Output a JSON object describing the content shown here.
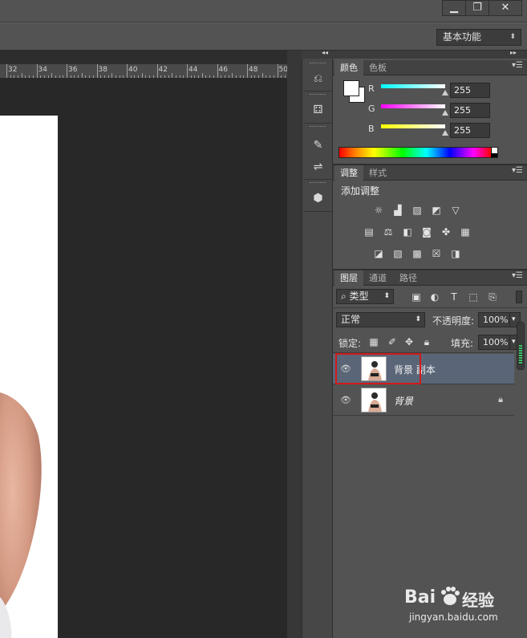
{
  "window": {
    "minimize": "▁",
    "restore": "❐",
    "close": "✕"
  },
  "options_bar": {
    "workspace": "基本功能"
  },
  "ruler": {
    "labels": [
      "32",
      "34",
      "36",
      "38",
      "40",
      "42",
      "44",
      "46",
      "48",
      "50"
    ]
  },
  "dock": {
    "collapse_arrows": "◂◂",
    "expand_arrows": "▸▸"
  },
  "color_panel": {
    "tabs": [
      "颜色",
      "色板"
    ],
    "channels": [
      {
        "label": "R",
        "value": "255",
        "gradient": "linear-gradient(to right,#00ffff,#ffffff)"
      },
      {
        "label": "G",
        "value": "255",
        "gradient": "linear-gradient(to right,#ff00ff,#ffffff)"
      },
      {
        "label": "B",
        "value": "255",
        "gradient": "linear-gradient(to right,#ffff00,#ffffff)"
      }
    ]
  },
  "adjustments_panel": {
    "tabs": [
      "调整",
      "样式"
    ],
    "title": "添加调整",
    "icon_rows": [
      [
        "brightness-contrast-icon",
        "levels-icon",
        "curves-icon",
        "exposure-icon",
        "vibrance-icon"
      ],
      [
        "hue-saturation-icon",
        "color-balance-icon",
        "black-white-icon",
        "photo-filter-icon",
        "channel-mixer-icon",
        "color-lookup-icon"
      ],
      [
        "invert-icon",
        "posterize-icon",
        "threshold-icon",
        "selective-color-icon",
        "gradient-map-icon"
      ]
    ]
  },
  "layers_panel": {
    "tabs": [
      "图层",
      "通道",
      "路径"
    ],
    "filter_kind": "类型",
    "blend_mode": "正常",
    "opacity_label": "不透明度:",
    "opacity_value": "100%",
    "lock_label": "锁定:",
    "fill_label": "填充:",
    "fill_value": "100%",
    "layers": [
      {
        "name": "背景 副本",
        "selected": true,
        "locked": false
      },
      {
        "name": "背景",
        "selected": false,
        "locked": true
      }
    ]
  },
  "watermark": {
    "brand": "Bai",
    "brand2": "经验",
    "url": "jingyan.baidu.com"
  },
  "colors": {
    "selected_layer_bg": "#5a6678",
    "highlight_red": "#d11a1a",
    "panel_bg": "#535353"
  }
}
